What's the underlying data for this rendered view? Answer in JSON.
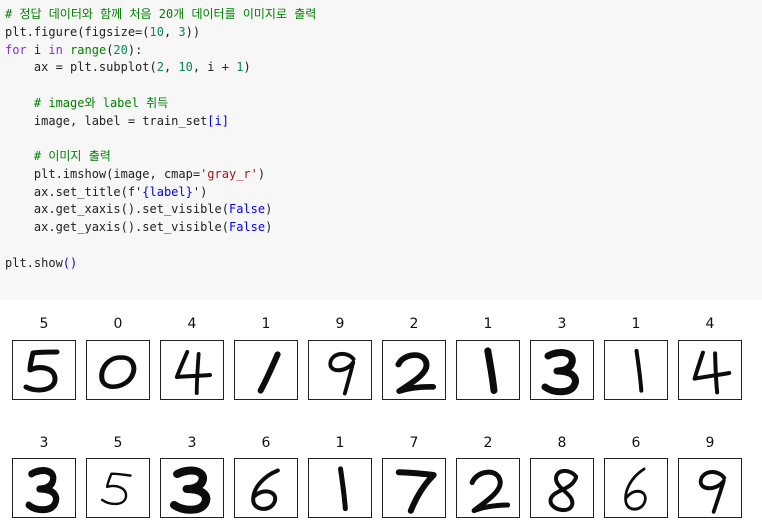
{
  "code_cell": {
    "lines": [
      [
        {
          "t": "# 정답 데이터와 함께 처음 20개 데이터를 이미지로 출력",
          "c": "cm"
        }
      ],
      [
        {
          "t": "plt.figure(figsize",
          "c": ""
        },
        {
          "t": "=",
          "c": ""
        },
        {
          "t": "(",
          "c": ""
        },
        {
          "t": "10",
          "c": "nm"
        },
        {
          "t": ", ",
          "c": ""
        },
        {
          "t": "3",
          "c": "nm"
        },
        {
          "t": "))",
          "c": ""
        }
      ],
      [
        {
          "t": "for",
          "c": "kw"
        },
        {
          "t": " i ",
          "c": ""
        },
        {
          "t": "in",
          "c": "kw"
        },
        {
          "t": " ",
          "c": ""
        },
        {
          "t": "range",
          "c": "bi"
        },
        {
          "t": "(",
          "c": ""
        },
        {
          "t": "20",
          "c": "nm"
        },
        {
          "t": "):",
          "c": ""
        }
      ],
      [
        {
          "t": "    ax = plt.subplot(",
          "c": ""
        },
        {
          "t": "2",
          "c": "nm"
        },
        {
          "t": ", ",
          "c": ""
        },
        {
          "t": "10",
          "c": "nm"
        },
        {
          "t": ", i + ",
          "c": ""
        },
        {
          "t": "1",
          "c": "nm"
        },
        {
          "t": ")",
          "c": ""
        }
      ],
      [],
      [
        {
          "t": "    # image와 label 취득",
          "c": "cm"
        }
      ],
      [
        {
          "t": "    image, label = train_set",
          "c": ""
        },
        {
          "t": "[i]",
          "c": "br"
        }
      ],
      [],
      [
        {
          "t": "    # 이미지 출력",
          "c": "cm"
        }
      ],
      [
        {
          "t": "    plt.imshow(image, cmap=",
          "c": ""
        },
        {
          "t": "'gray_r'",
          "c": "st"
        },
        {
          "t": ")",
          "c": ""
        }
      ],
      [
        {
          "t": "    ax.set_title(f'",
          "c": ""
        },
        {
          "t": "{label}",
          "c": "br"
        },
        {
          "t": "')",
          "c": ""
        }
      ],
      [
        {
          "t": "    ax.get_xaxis().set_visible(",
          "c": ""
        },
        {
          "t": "False",
          "c": "cst"
        },
        {
          "t": ")",
          "c": ""
        }
      ],
      [
        {
          "t": "    ax.get_yaxis().set_visible(",
          "c": ""
        },
        {
          "t": "False",
          "c": "cst"
        },
        {
          "t": ")",
          "c": ""
        }
      ],
      [],
      [
        {
          "t": "plt.show",
          "c": ""
        },
        {
          "t": "()",
          "c": "br"
        }
      ]
    ]
  },
  "figure": {
    "labels": [
      "5",
      "0",
      "4",
      "1",
      "9",
      "2",
      "1",
      "3",
      "1",
      "4",
      "3",
      "5",
      "3",
      "6",
      "1",
      "7",
      "2",
      "8",
      "6",
      "9"
    ],
    "columns": 10,
    "rows": 2
  }
}
